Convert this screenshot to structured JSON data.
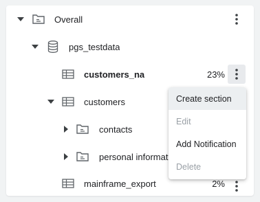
{
  "tree": {
    "rows": [
      {
        "label": "Overall",
        "icon": "folder-icon",
        "caret": "down"
      },
      {
        "label": "pgs_testdata",
        "icon": "database-icon",
        "caret": "down"
      },
      {
        "label": "customers_na",
        "icon": "table-icon",
        "percent": "23%"
      },
      {
        "label": "customers",
        "icon": "table-icon",
        "caret": "down"
      },
      {
        "label": "contacts",
        "icon": "folder-icon",
        "caret": "right"
      },
      {
        "label": "personal information",
        "icon": "folder-icon",
        "caret": "right"
      },
      {
        "label": "mainframe_export",
        "icon": "table-icon",
        "percent": "2%"
      }
    ]
  },
  "context_menu": {
    "items": [
      {
        "label": "Create section",
        "state": "hover"
      },
      {
        "label": "Edit",
        "state": "disabled"
      },
      {
        "label": "Add Notification",
        "state": "enabled"
      },
      {
        "label": "Delete",
        "state": "disabled"
      }
    ]
  },
  "colors": {
    "icon": "#5f6368",
    "disabled_text": "#9aa0a6",
    "hover_bg": "#eceff1"
  }
}
